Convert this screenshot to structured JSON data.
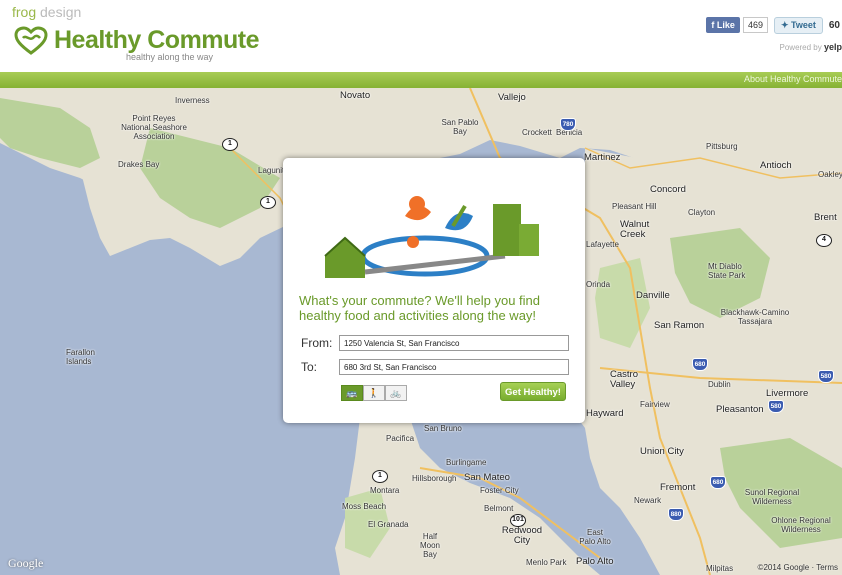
{
  "header": {
    "brand_prefix": "frog",
    "brand_suffix": "design",
    "title": "Healthy Commute",
    "tagline": "healthy along the way",
    "fb_like": "Like",
    "fb_count": "469",
    "tweet": "Tweet",
    "tweet_count": "60",
    "powered_by": "Powered by",
    "powered_brand": "yelp",
    "about_link": "About Healthy Commute"
  },
  "map": {
    "labels": {
      "novato": "Novato",
      "vallejo": "Vallejo",
      "inverness": "Inverness",
      "point_reyes": "Point Reyes National Seashore Association",
      "drakes_bay": "Drakes Bay",
      "san_pablo_bay": "San Pablo Bay",
      "crockett": "Crockett",
      "benicia": "Benicia",
      "martinez": "Martinez",
      "concord": "Concord",
      "pleasant_hill": "Pleasant Hill",
      "clayton": "Clayton",
      "walnut_creek": "Walnut Creek",
      "lafayette": "Lafayette",
      "antioch": "Antioch",
      "pittsburg": "Pittsburg",
      "oakley": "Oakley",
      "brentwood": "Brent",
      "orinda": "Orinda",
      "danville": "Danville",
      "mt_diablo": "Mt Diablo State Park",
      "san_ramon": "San Ramon",
      "blackhawk": "Blackhawk-Camino Tassajara",
      "castro_valley": "Castro Valley",
      "dublin": "Dublin",
      "livermore": "Livermore",
      "pleasanton": "Pleasanton",
      "hayward": "Hayward",
      "fairview": "Fairview",
      "union_city": "Union City",
      "fremont": "Fremont",
      "newark": "Newark",
      "san_bruno": "San Bruno",
      "pacifica": "Pacifica",
      "burlingame": "Burlingame",
      "san_mateo": "San Mateo",
      "hillsborough": "Hillsborough",
      "foster_city": "Foster City",
      "montara": "Montara",
      "moss_beach": "Moss Beach",
      "el_granada": "El Granada",
      "half_moon_bay": "Half Moon Bay",
      "belmont": "Belmont",
      "redwood_city": "Redwood City",
      "east_palo_alto": "East Palo Alto",
      "menlo_park": "Menlo Park",
      "palo_alto": "Palo Alto",
      "milpitas": "Milpitas",
      "farallon": "Farallon Islands",
      "lagunitas": "Lagunitas-Forest Knolls",
      "sunol": "Sunol Regional Wilderness",
      "ohlone": "Ohlone Regional Wilderness"
    },
    "google": "Google",
    "copyright": "©2014 Google · Terms"
  },
  "dialog": {
    "tagline": "What's your commute? We'll help you find healthy food and activities along the way!",
    "from_label": "From:",
    "from_value": "1250 Valencia St, San Francisco",
    "to_label": "To:",
    "to_value": "680 3rd St, San Francisco",
    "mode_transit": "🚌",
    "mode_walk": "🚶",
    "mode_bike": "🚲",
    "go_button": "Get Healthy!"
  },
  "colors": {
    "brand_green": "#6a9a2a",
    "bar_green": "#9ac24a",
    "water": "#a8b8d2",
    "land": "#e8e4d8",
    "park": "#b9d19a"
  }
}
